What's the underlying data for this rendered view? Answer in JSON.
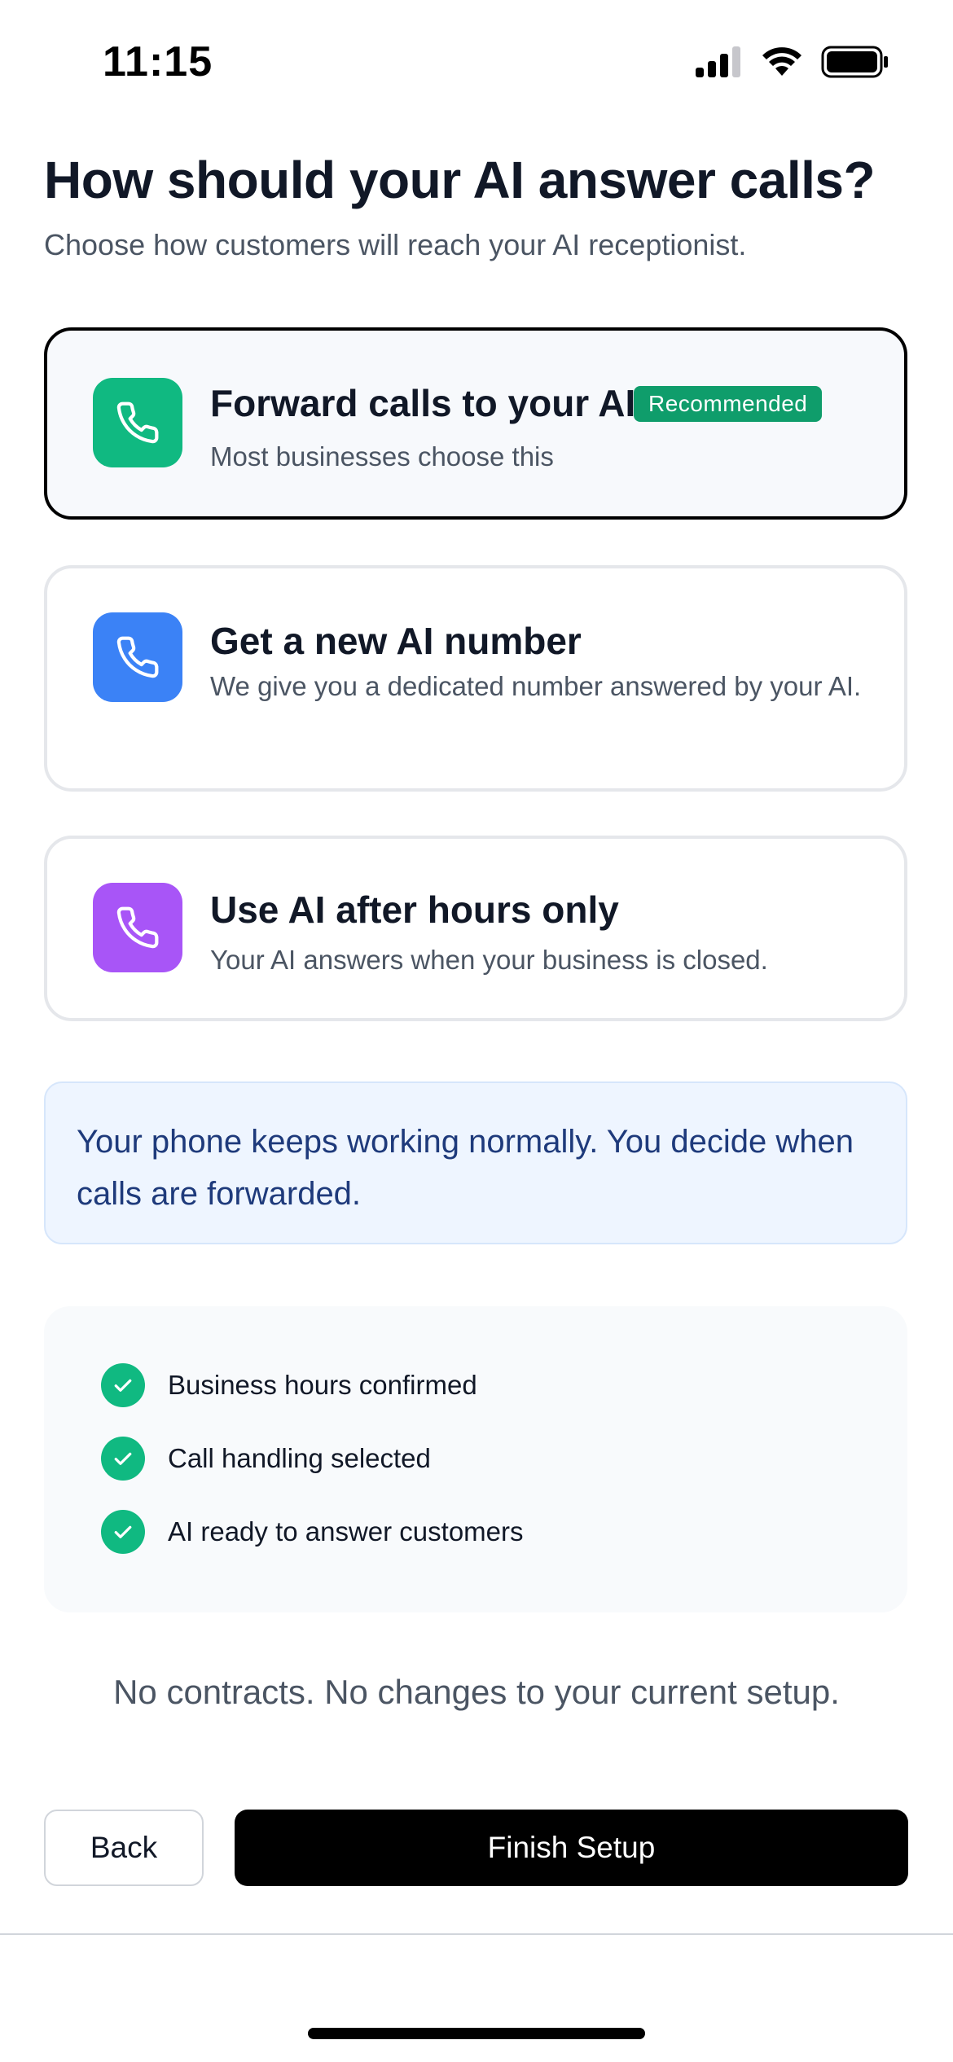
{
  "status_bar": {
    "time": "11:15"
  },
  "header": {
    "title": "How should your AI answer calls?",
    "subtitle": "Choose how customers will reach your AI receptionist."
  },
  "options": [
    {
      "title": "Forward calls to your AI",
      "badge": "Recommended",
      "description": "Most businesses choose this",
      "icon": "phone-icon",
      "color": "#10b981",
      "selected": true
    },
    {
      "title": "Get a new AI number",
      "description": "We give you a dedicated number answered by your AI.",
      "icon": "phone-icon",
      "color": "#3b82f6",
      "selected": false
    },
    {
      "title": "Use AI after hours only",
      "description": "Your AI answers when your business is closed.",
      "icon": "phone-icon",
      "color": "#a855f7",
      "selected": false
    }
  ],
  "info": {
    "text": "Your phone keeps working normally. You decide when calls are forwarded."
  },
  "checklist": [
    {
      "label": "Business hours confirmed",
      "icon": "check-icon"
    },
    {
      "label": "Call handling selected",
      "icon": "check-icon"
    },
    {
      "label": "AI ready to answer customers",
      "icon": "check-icon"
    }
  ],
  "footer_note": "No contracts. No changes to your current setup.",
  "buttons": {
    "back": "Back",
    "finish": "Finish Setup"
  },
  "colors": {
    "accent_green": "#10b981",
    "badge_green": "#0f9d6b",
    "info_bg": "#eef5ff",
    "info_text": "#1e3a7b"
  }
}
